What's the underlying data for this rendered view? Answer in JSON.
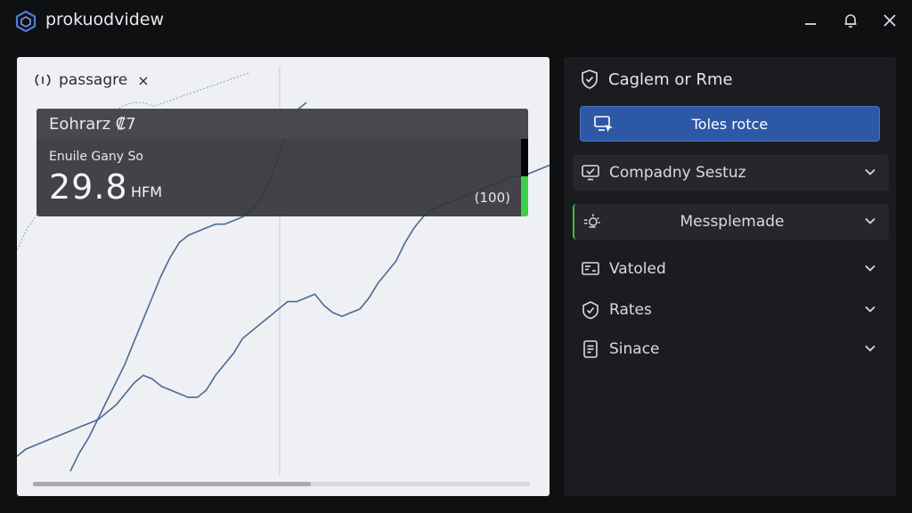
{
  "app": {
    "title": "prokuodvidew"
  },
  "chart_panel": {
    "tab_label": "passagre",
    "tab_close": "×",
    "overlay": {
      "header": "Eohrarz ₡7",
      "subtitle": "Enuile Gany So",
      "value": "29.8",
      "unit": "HFM",
      "right_value": "(100)"
    },
    "scroll_position": 0.56
  },
  "side_panel": {
    "header": "Caglem or Rme",
    "primary_button": "Toles rotce",
    "items": [
      {
        "label": "Compadny Sestuz",
        "icon": "monitor-check-icon"
      },
      {
        "label": "Messplemade",
        "icon": "sparkle-icon"
      },
      {
        "label": "Vatoled",
        "icon": "id-card-icon"
      },
      {
        "label": "Rates",
        "icon": "badge-check-icon"
      },
      {
        "label": "Sinace",
        "icon": "document-icon"
      }
    ]
  },
  "colors": {
    "accent_blue": "#2d58a6",
    "accent_green": "#3bd14b",
    "panel_dark": "#1b1c1f",
    "chart_bg": "#eef0f4",
    "series": "#3a5b86"
  },
  "chart_data": {
    "type": "line",
    "series": [
      {
        "values": [
          0.04,
          0.06,
          0.07,
          0.08,
          0.09,
          0.1,
          0.11,
          0.12,
          0.13,
          0.14,
          0.16,
          0.18,
          0.21,
          0.24,
          0.26,
          0.25,
          0.23,
          0.22,
          0.21,
          0.2,
          0.2,
          0.22,
          0.26,
          0.29,
          0.32,
          0.36,
          0.38,
          0.4,
          0.42,
          0.44,
          0.46,
          0.46,
          0.47,
          0.48,
          0.45,
          0.43,
          0.42,
          0.43,
          0.44,
          0.47,
          0.51,
          0.54,
          0.57,
          0.62,
          0.66,
          0.69,
          0.71,
          0.72,
          0.73,
          0.74,
          0.75,
          0.76,
          0.77,
          0.78,
          0.79,
          0.8,
          0.8,
          0.81,
          0.82,
          0.83
        ]
      },
      {
        "values": [
          0.0,
          0.05,
          0.09,
          0.14,
          0.19,
          0.24,
          0.29,
          0.35,
          0.41,
          0.47,
          0.53,
          0.58,
          0.62,
          0.64,
          0.65,
          0.66,
          0.67,
          0.67,
          0.68,
          0.69,
          0.71,
          0.74,
          0.79,
          0.86,
          0.93,
          0.98,
          1.0
        ]
      },
      {
        "values": [
          0.6,
          0.66,
          0.7,
          0.76,
          0.82,
          0.87,
          0.9,
          0.93,
          0.95,
          0.97,
          0.99,
          1.0,
          1.0,
          0.99,
          1.0,
          1.01,
          1.02,
          1.03,
          1.04,
          1.05,
          1.06,
          1.07,
          1.08
        ]
      }
    ]
  }
}
